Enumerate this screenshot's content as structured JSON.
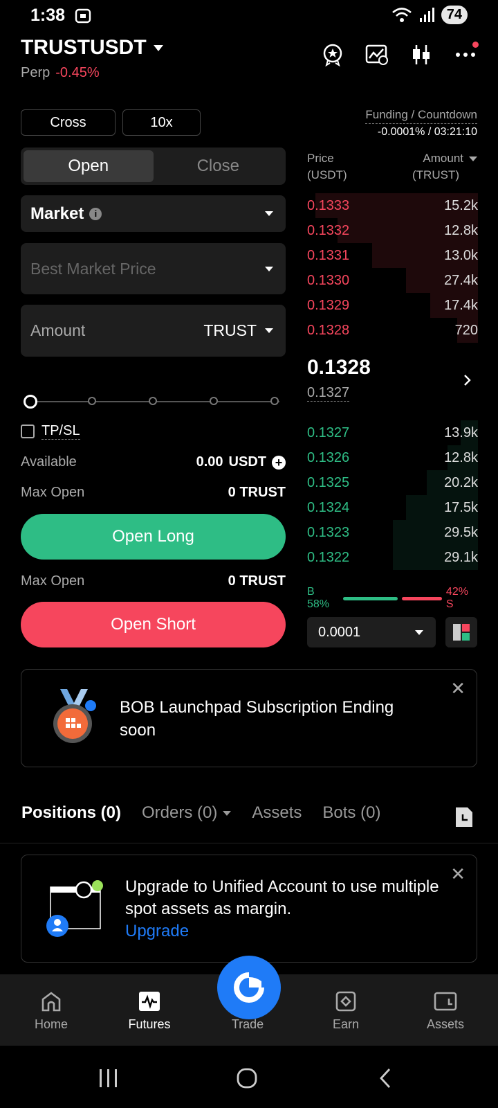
{
  "status_bar": {
    "time": "1:38",
    "battery": "74"
  },
  "header": {
    "pair": "TRUSTUSDT",
    "type": "Perp",
    "change": "-0.45%"
  },
  "margin_mode": "Cross",
  "leverage": "10x",
  "funding": {
    "label": "Funding / Countdown",
    "value": "-0.0001% / 03:21:10"
  },
  "order_tabs": {
    "open": "Open",
    "close": "Close"
  },
  "order_type": "Market",
  "price_placeholder": "Best Market Price",
  "amount": {
    "label": "Amount",
    "unit": "TRUST"
  },
  "tpsl_label": "TP/SL",
  "available": {
    "label": "Available",
    "value": "0.00",
    "unit": "USDT"
  },
  "max_open_long": {
    "label": "Max Open",
    "value": "0 TRUST"
  },
  "max_open_short": {
    "label": "Max Open",
    "value": "0 TRUST"
  },
  "buttons": {
    "long": "Open Long",
    "short": "Open Short"
  },
  "orderbook": {
    "price_header": "Price",
    "price_unit": "(USDT)",
    "amount_header": "Amount",
    "amount_unit": "(TRUST)",
    "asks": [
      {
        "price": "0.1333",
        "amount": "15.2k",
        "depth": 0.95
      },
      {
        "price": "0.1332",
        "amount": "12.8k",
        "depth": 0.82
      },
      {
        "price": "0.1331",
        "amount": "13.0k",
        "depth": 0.62
      },
      {
        "price": "0.1330",
        "amount": "27.4k",
        "depth": 0.42
      },
      {
        "price": "0.1329",
        "amount": "17.4k",
        "depth": 0.28
      },
      {
        "price": "0.1328",
        "amount": "720",
        "depth": 0.12
      }
    ],
    "last_price": "0.1328",
    "mark_price": "0.1327",
    "bids": [
      {
        "price": "0.1327",
        "amount": "13.9k",
        "depth": 0.1
      },
      {
        "price": "0.1326",
        "amount": "12.8k",
        "depth": 0.18
      },
      {
        "price": "0.1325",
        "amount": "20.2k",
        "depth": 0.3
      },
      {
        "price": "0.1324",
        "amount": "17.5k",
        "depth": 0.42
      },
      {
        "price": "0.1323",
        "amount": "29.5k",
        "depth": 0.5
      },
      {
        "price": "0.1322",
        "amount": "29.1k",
        "depth": 0.5
      }
    ],
    "buy_ratio": "B 58%",
    "sell_ratio": "42% S",
    "buy_fraction": 0.58,
    "precision": "0.0001"
  },
  "launchpad_banner": {
    "text": "BOB Launchpad Subscription Ending soon"
  },
  "position_tabs": [
    "Positions (0)",
    "Orders (0)",
    "Assets",
    "Bots (0)"
  ],
  "upgrade_banner": {
    "text": "Upgrade to Unified Account to use multiple spot assets as margin.",
    "link": "Upgrade"
  },
  "bottom_nav": [
    "Home",
    "Futures",
    "Trade",
    "Earn",
    "Assets"
  ],
  "colors": {
    "green": "#2ebd85",
    "red": "#f6465d",
    "blue": "#1f7bf7"
  }
}
